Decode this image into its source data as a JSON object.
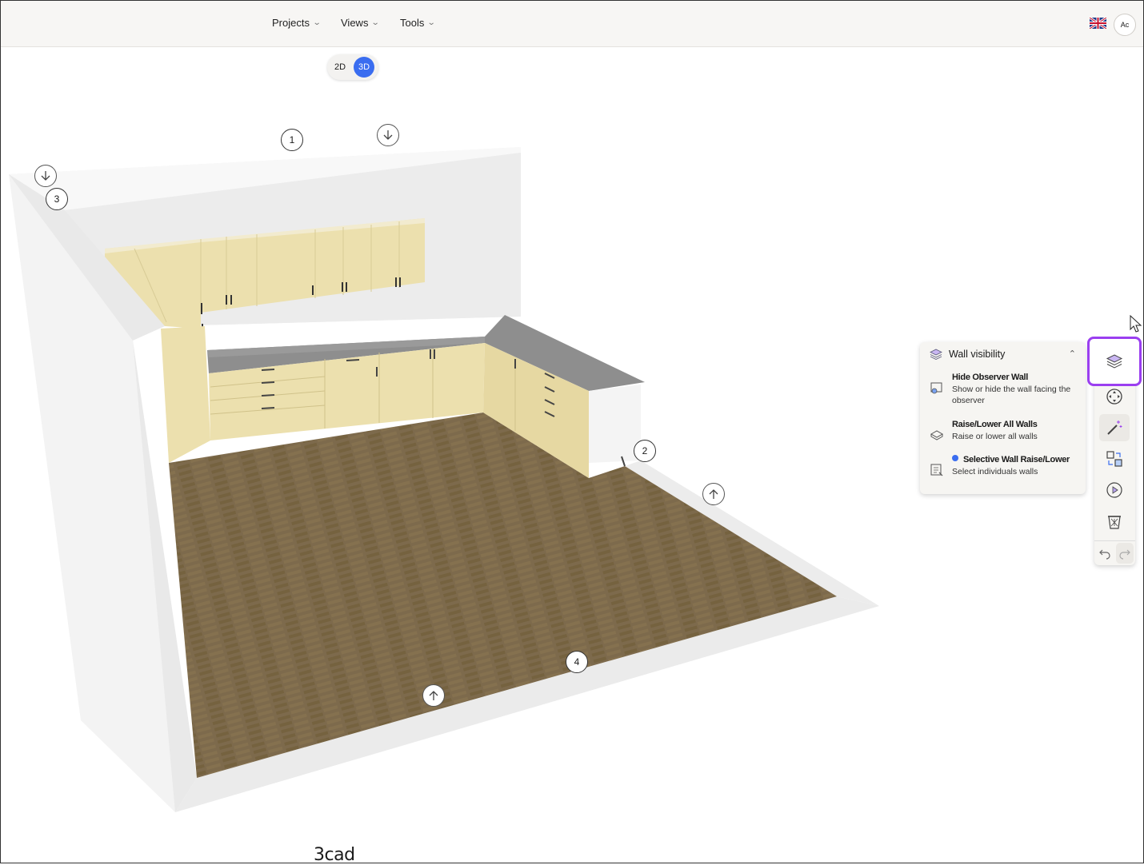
{
  "nav": {
    "projects": "Projects",
    "views": "Views",
    "tools": "Tools"
  },
  "user": {
    "avatar_initials": "Ac",
    "language_flag": "uk-flag-icon"
  },
  "view_toggle": {
    "option_2d": "2D",
    "option_3d": "3D",
    "active": "3D"
  },
  "wall_markers": [
    "1",
    "2",
    "3",
    "4"
  ],
  "wall_visibility_panel": {
    "title": "Wall visibility",
    "options": [
      {
        "title": "Hide Observer Wall",
        "description": "Show or hide the wall facing the observer",
        "selected": false
      },
      {
        "title": "Raise/Lower All Walls",
        "description": "Raise or lower all walls",
        "selected": false
      },
      {
        "title": "Selective Wall Raise/Lower",
        "description": "Select individuals walls",
        "selected": true
      }
    ]
  },
  "toolbar": {
    "tools": [
      "layers-icon",
      "move-icon",
      "magic-wand-icon",
      "swap-objects-icon",
      "play-icon",
      "trash-icon"
    ],
    "undo": "undo-icon",
    "redo": "redo-icon"
  },
  "brand": {
    "logo": "3cad"
  },
  "colors": {
    "accent": "#3a6df0",
    "highlight": "#9b3ff0",
    "cabinet": "#ece0ae",
    "countertop": "#8e8e8e",
    "floor": "#7d6a4c"
  }
}
